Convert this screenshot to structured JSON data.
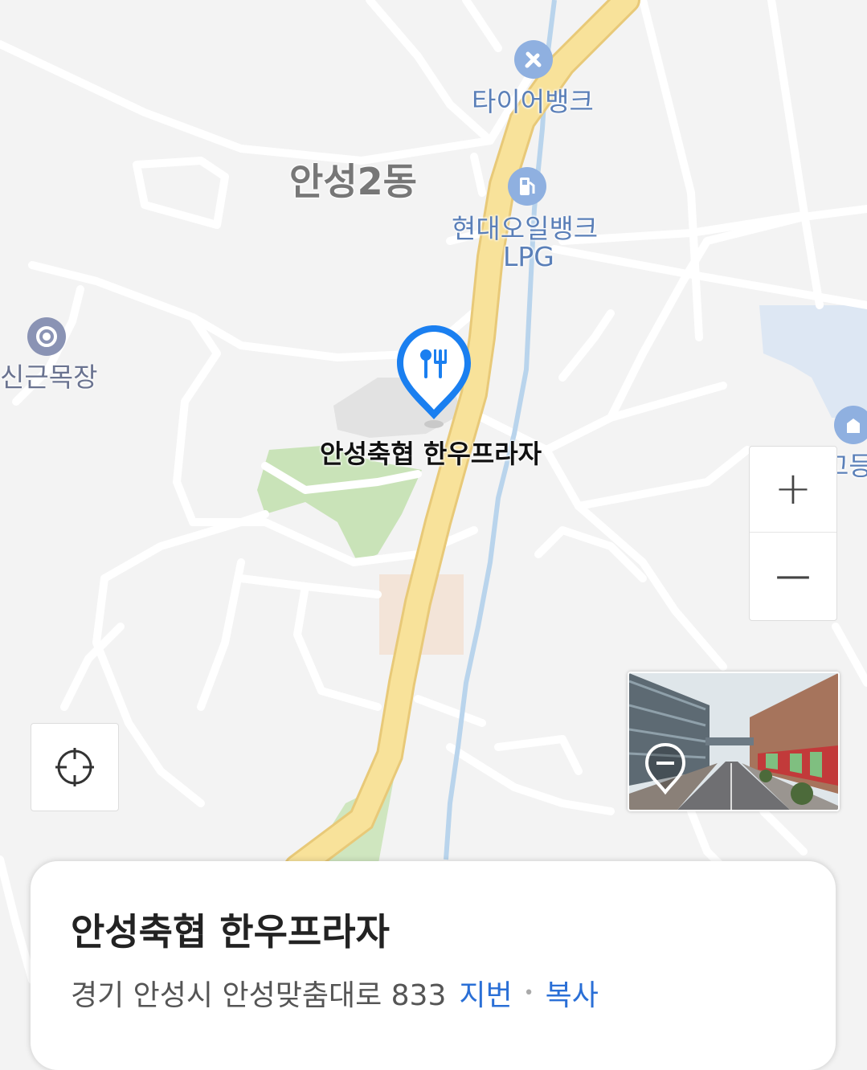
{
  "map": {
    "area_label": "안성2동",
    "pois": [
      {
        "name": "타이어뱅크",
        "icon": "wrench-icon"
      },
      {
        "name": "현대오일뱅크\nLPG",
        "line1": "현대오일뱅크",
        "line2": "LPG",
        "icon": "gas-station-icon"
      },
      {
        "name": "신근목장",
        "icon": "target-icon"
      },
      {
        "name": "가온고등",
        "icon": "school-icon"
      }
    ],
    "selected_place": {
      "name": "안성축협 한우프라자",
      "icon": "restaurant-icon"
    }
  },
  "controls": {
    "zoom_in": "+",
    "zoom_out": "—",
    "locate_icon": "crosshair-icon",
    "streetview_icon": "street-view-pin-icon"
  },
  "card": {
    "title": "안성축협 한우프라자",
    "address": "경기 안성시 안성맞춤대로 833",
    "jibun_link": "지번",
    "separator": "•",
    "copy_link": "복사"
  },
  "colors": {
    "accent": "#1a7ff0",
    "link": "#2a6fd6",
    "road_major": "#f6dd8a",
    "park": "#c7e2b4",
    "water": "#dbe7f5"
  }
}
